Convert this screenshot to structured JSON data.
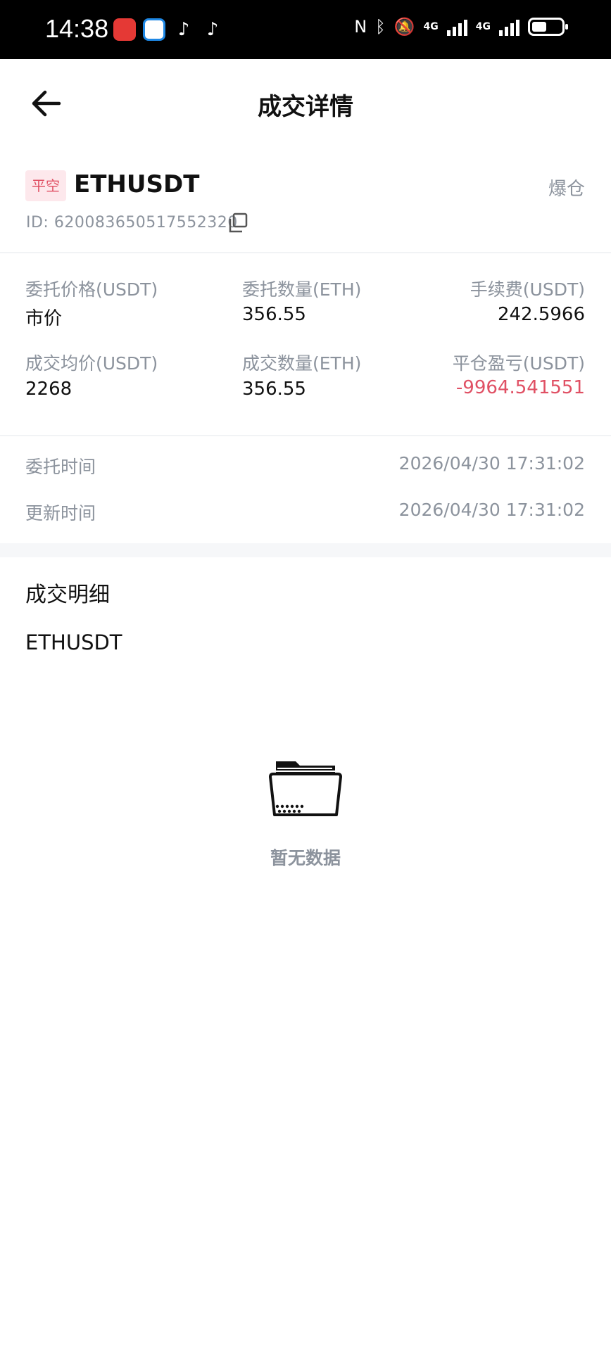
{
  "status_bar": {
    "time": "14:38",
    "network_1": "4G",
    "network_2": "4G"
  },
  "header": {
    "title": "成交详情"
  },
  "order": {
    "side_tag": "平空",
    "symbol": "ETHUSDT",
    "status": "爆仓",
    "id_text": "ID:  6200836505175523​20"
  },
  "fields": {
    "entrust_price_label": "委托价格(USDT)",
    "entrust_price_value": "市价",
    "entrust_qty_label": "委托数量(ETH)",
    "entrust_qty_value": "356.55",
    "fee_label": "手续费(USDT)",
    "fee_value": "242.5966",
    "avg_price_label": "成交均价(USDT)",
    "avg_price_value": "2268",
    "filled_qty_label": "成交数量(ETH)",
    "filled_qty_value": "356.55",
    "pnl_label": "平仓盈亏(USDT)",
    "pnl_value": "-9964.541551"
  },
  "times": {
    "entrust_time_label": "委托时间",
    "entrust_time_value": "2026/04/30 17:31:02",
    "update_time_label": "更新时间",
    "update_time_value": "2026/04/30 17:31:02"
  },
  "details": {
    "title": "成交明细",
    "symbol": "ETHUSDT",
    "empty_text": "暂无数据"
  },
  "colors": {
    "negative": "#e05064",
    "muted": "#8c939d",
    "tag_bg": "#fde8ec"
  },
  "icons": [
    "back-arrow-icon",
    "copy-icon",
    "empty-folder-icon",
    "bluetooth-icon",
    "mute-icon",
    "nfc-icon"
  ]
}
